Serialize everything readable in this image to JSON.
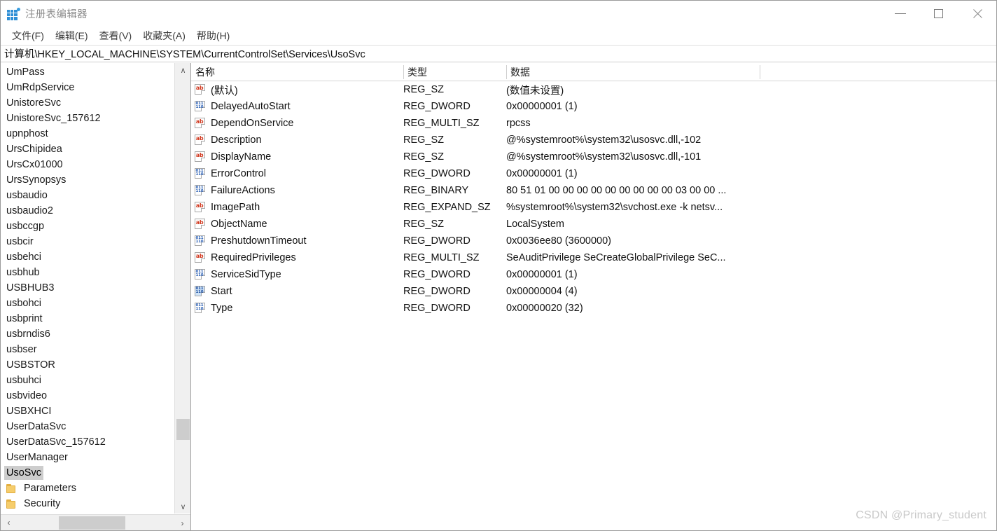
{
  "window": {
    "title": "注册表编辑器",
    "icon": "registry-grid-icon",
    "controls": {
      "minimize": "minimize-icon",
      "maximize": "maximize-icon",
      "close": "close-icon"
    }
  },
  "menubar": {
    "items": [
      {
        "label": "文件(F)"
      },
      {
        "label": "编辑(E)"
      },
      {
        "label": "查看(V)"
      },
      {
        "label": "收藏夹(A)"
      },
      {
        "label": "帮助(H)"
      }
    ]
  },
  "address": {
    "path": "计算机\\HKEY_LOCAL_MACHINE\\SYSTEM\\CurrentControlSet\\Services\\UsoSvc"
  },
  "tree": {
    "items": [
      {
        "label": "UmPass",
        "type": "key",
        "selected": false,
        "indent": 0
      },
      {
        "label": "UmRdpService",
        "type": "key",
        "selected": false,
        "indent": 0
      },
      {
        "label": "UnistoreSvc",
        "type": "key",
        "selected": false,
        "indent": 0
      },
      {
        "label": "UnistoreSvc_157612",
        "type": "key",
        "selected": false,
        "indent": 0
      },
      {
        "label": "upnphost",
        "type": "key",
        "selected": false,
        "indent": 0
      },
      {
        "label": "UrsChipidea",
        "type": "key",
        "selected": false,
        "indent": 0
      },
      {
        "label": "UrsCx01000",
        "type": "key",
        "selected": false,
        "indent": 0
      },
      {
        "label": "UrsSynopsys",
        "type": "key",
        "selected": false,
        "indent": 0
      },
      {
        "label": "usbaudio",
        "type": "key",
        "selected": false,
        "indent": 0
      },
      {
        "label": "usbaudio2",
        "type": "key",
        "selected": false,
        "indent": 0
      },
      {
        "label": "usbccgp",
        "type": "key",
        "selected": false,
        "indent": 0
      },
      {
        "label": "usbcir",
        "type": "key",
        "selected": false,
        "indent": 0
      },
      {
        "label": "usbehci",
        "type": "key",
        "selected": false,
        "indent": 0
      },
      {
        "label": "usbhub",
        "type": "key",
        "selected": false,
        "indent": 0
      },
      {
        "label": "USBHUB3",
        "type": "key",
        "selected": false,
        "indent": 0
      },
      {
        "label": "usbohci",
        "type": "key",
        "selected": false,
        "indent": 0
      },
      {
        "label": "usbprint",
        "type": "key",
        "selected": false,
        "indent": 0
      },
      {
        "label": "usbrndis6",
        "type": "key",
        "selected": false,
        "indent": 0
      },
      {
        "label": "usbser",
        "type": "key",
        "selected": false,
        "indent": 0
      },
      {
        "label": "USBSTOR",
        "type": "key",
        "selected": false,
        "indent": 0
      },
      {
        "label": "usbuhci",
        "type": "key",
        "selected": false,
        "indent": 0
      },
      {
        "label": "usbvideo",
        "type": "key",
        "selected": false,
        "indent": 0
      },
      {
        "label": "USBXHCI",
        "type": "key",
        "selected": false,
        "indent": 0
      },
      {
        "label": "UserDataSvc",
        "type": "key",
        "selected": false,
        "indent": 0
      },
      {
        "label": "UserDataSvc_157612",
        "type": "key",
        "selected": false,
        "indent": 0
      },
      {
        "label": "UserManager",
        "type": "key",
        "selected": false,
        "indent": 0
      },
      {
        "label": "UsoSvc",
        "type": "key",
        "selected": true,
        "indent": 0
      },
      {
        "label": "Parameters",
        "type": "folder",
        "selected": false,
        "indent": 1
      },
      {
        "label": "Security",
        "type": "folder",
        "selected": false,
        "indent": 1
      }
    ],
    "scroll": {
      "up_arrow": "chevron-up-icon",
      "down_arrow": "chevron-down-icon",
      "left_arrow": "chevron-left-icon",
      "right_arrow": "chevron-right-icon"
    }
  },
  "values": {
    "columns": [
      {
        "label": "名称"
      },
      {
        "label": "类型"
      },
      {
        "label": "数据"
      }
    ],
    "rows": [
      {
        "icon": "string-value-icon",
        "name": "(默认)",
        "type": "REG_SZ",
        "data": "(数值未设置)",
        "selected": false
      },
      {
        "icon": "binary-value-icon",
        "name": "DelayedAutoStart",
        "type": "REG_DWORD",
        "data": "0x00000001 (1)",
        "selected": false
      },
      {
        "icon": "string-value-icon",
        "name": "DependOnService",
        "type": "REG_MULTI_SZ",
        "data": "rpcss",
        "selected": false
      },
      {
        "icon": "string-value-icon",
        "name": "Description",
        "type": "REG_SZ",
        "data": "@%systemroot%\\system32\\usosvc.dll,-102",
        "selected": false
      },
      {
        "icon": "string-value-icon",
        "name": "DisplayName",
        "type": "REG_SZ",
        "data": "@%systemroot%\\system32\\usosvc.dll,-101",
        "selected": false
      },
      {
        "icon": "binary-value-icon",
        "name": "ErrorControl",
        "type": "REG_DWORD",
        "data": "0x00000001 (1)",
        "selected": false
      },
      {
        "icon": "binary-value-icon",
        "name": "FailureActions",
        "type": "REG_BINARY",
        "data": "80 51 01 00 00 00 00 00 00 00 00 00 03 00 00 ...",
        "selected": false
      },
      {
        "icon": "string-value-icon",
        "name": "ImagePath",
        "type": "REG_EXPAND_SZ",
        "data": "%systemroot%\\system32\\svchost.exe -k netsv...",
        "selected": false
      },
      {
        "icon": "string-value-icon",
        "name": "ObjectName",
        "type": "REG_SZ",
        "data": "LocalSystem",
        "selected": false
      },
      {
        "icon": "binary-value-icon",
        "name": "PreshutdownTimeout",
        "type": "REG_DWORD",
        "data": "0x0036ee80 (3600000)",
        "selected": false
      },
      {
        "icon": "string-value-icon",
        "name": "RequiredPrivileges",
        "type": "REG_MULTI_SZ",
        "data": "SeAuditPrivilege SeCreateGlobalPrivilege SeC...",
        "selected": false
      },
      {
        "icon": "binary-value-icon",
        "name": "ServiceSidType",
        "type": "REG_DWORD",
        "data": "0x00000001 (1)",
        "selected": false
      },
      {
        "icon": "binary-value-icon",
        "name": "Start",
        "type": "REG_DWORD",
        "data": "0x00000004 (4)",
        "selected": true
      },
      {
        "icon": "binary-value-icon",
        "name": "Type",
        "type": "REG_DWORD",
        "data": "0x00000020 (32)",
        "selected": false
      }
    ]
  },
  "watermark": {
    "text": "CSDN @Primary_student"
  },
  "icon_glyphs": {
    "string": "ab",
    "binary_top": "011",
    "binary_bottom": "110",
    "chevron_up": "∧",
    "chevron_down": "∨",
    "chevron_left": "‹",
    "chevron_right": "›"
  },
  "colors": {
    "string_icon": "#d13b22",
    "binary_icon": "#2a5fb4",
    "folder": "#f6cd6b",
    "selection": "#cdcdcd",
    "watermark": "#c9c9c9"
  }
}
